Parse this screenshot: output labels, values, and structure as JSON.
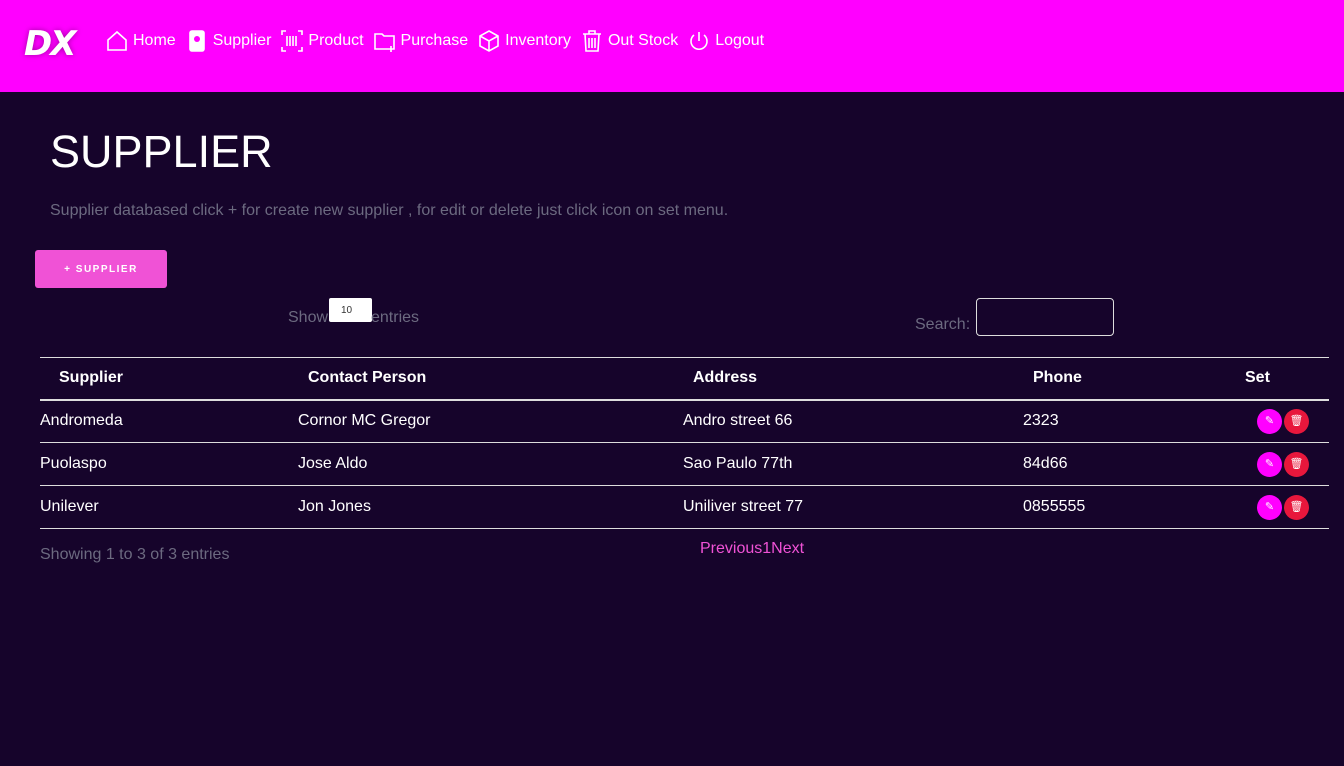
{
  "brand": {
    "logo": "DX"
  },
  "nav": [
    {
      "label": "Home",
      "icon": "home-icon"
    },
    {
      "label": "Supplier",
      "icon": "badge-icon"
    },
    {
      "label": "Product",
      "icon": "barcode-icon"
    },
    {
      "label": "Purchase",
      "icon": "folder-plus-icon"
    },
    {
      "label": "Inventory",
      "icon": "box-icon"
    },
    {
      "label": "Out Stock",
      "icon": "trash-icon"
    },
    {
      "label": "Logout",
      "icon": "power-icon"
    }
  ],
  "page": {
    "title": "SUPPLIER",
    "description": "Supplier databased click + for create new supplier , for edit or delete just click icon on set menu.",
    "add_label": "+ SUPPLIER"
  },
  "table_controls": {
    "show": "Show",
    "entries_value": "10",
    "entries": "entries",
    "search_label": "Search:",
    "search_value": ""
  },
  "table": {
    "headers": [
      "Supplier",
      "Contact Person",
      "Address",
      "Phone",
      "Set"
    ],
    "rows": [
      [
        "Andromeda",
        "Cornor MC Gregor",
        "Andro street 66",
        "2323"
      ],
      [
        "Puolaspo",
        "Jose Aldo",
        "Sao Paulo 77th",
        "84d66"
      ],
      [
        "Unilever",
        "Jon Jones",
        "Uniliver street 77",
        "0855555"
      ]
    ]
  },
  "footer": {
    "info": "Showing 1 to 3 of 3 entries",
    "previous": "Previous",
    "page": "1",
    "next": "Next"
  },
  "colors": {
    "nav": "#ff00ff",
    "bg": "#16042b",
    "button": "#f052d6",
    "delete": "#e8173c"
  }
}
